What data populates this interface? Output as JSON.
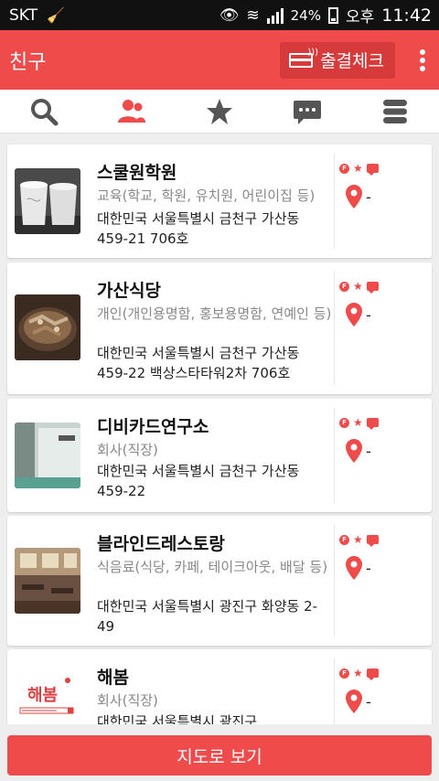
{
  "status_bar": {
    "carrier": "SKT",
    "battery": "24%",
    "ampm": "오후",
    "time": "11:42"
  },
  "app_bar": {
    "title": "친구",
    "attendance_button": "출결체크"
  },
  "tabs": [
    {
      "icon": "search-icon"
    },
    {
      "icon": "friends-icon",
      "active": true
    },
    {
      "icon": "star-icon"
    },
    {
      "icon": "chat-icon"
    },
    {
      "icon": "list-menu-icon"
    }
  ],
  "colors": {
    "accent": "#ef4b4b",
    "inactive_icon": "#555555"
  },
  "friends": [
    {
      "name": "스쿨원학원",
      "category": "교육(학교, 학원, 유치원, 어린이집 등)",
      "address": "대한민국 서울특별시 금천구 가산동 459-21 706호",
      "distance": "-",
      "thumbnail": "paper-cups-photo"
    },
    {
      "name": "가산식당",
      "category": "개인(개인용명함, 홍보용명함, 연예인 등)",
      "address": "대한민국 서울특별시 금천구 가산동 459-22 백상스타타워2차 706호",
      "distance": "-",
      "thumbnail": "food-dish-photo"
    },
    {
      "name": "디비카드연구소",
      "category": "회사(직장)",
      "address": "대한민국 서울특별시 금천구 가산동 459-22",
      "distance": "-",
      "thumbnail": "office-door-photo"
    },
    {
      "name": "블라인드레스토랑",
      "category": "식음료(식당, 카페, 테이크아웃, 배달 등)",
      "address": "대한민국 서울특별시 광진구 화양동 2-49",
      "distance": "-",
      "thumbnail": "restaurant-interior-photo"
    },
    {
      "name": "해봄",
      "category": "회사(직장)",
      "address": "대한민국 서울특별시 광진구",
      "distance": "-",
      "thumbnail": "haebom-logo",
      "logo_text": "해봄"
    }
  ],
  "bottom_button": "지도로 보기"
}
